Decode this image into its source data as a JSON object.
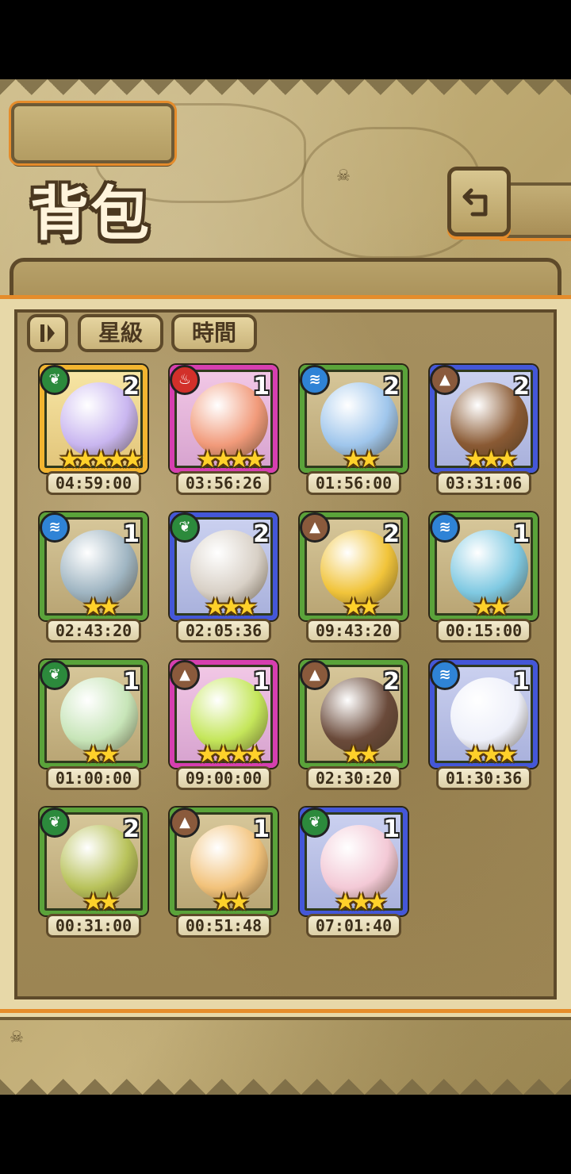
{
  "title": "背包",
  "filters": {
    "sort_icon": "sort-toggle-icon",
    "star_label": "星級",
    "time_label": "時間"
  },
  "cards": [
    {
      "element": "nature",
      "count": "2",
      "stars": 5,
      "timer": "04:59:00",
      "art": "#c9b6f0"
    },
    {
      "element": "fire",
      "count": "1",
      "stars": 4,
      "timer": "03:56:26",
      "art": "#f19a7a"
    },
    {
      "element": "water",
      "count": "2",
      "stars": 2,
      "timer": "01:56:00",
      "art": "#9fc6ec"
    },
    {
      "element": "earth",
      "count": "2",
      "stars": 3,
      "timer": "03:31:06",
      "art": "#8a5a34"
    },
    {
      "element": "water",
      "count": "1",
      "stars": 2,
      "timer": "02:43:20",
      "art": "#9fb5c2"
    },
    {
      "element": "nature",
      "count": "2",
      "stars": 3,
      "timer": "02:05:36",
      "art": "#d8d0c6"
    },
    {
      "element": "earth",
      "count": "2",
      "stars": 2,
      "timer": "09:43:20",
      "art": "#f1c43a"
    },
    {
      "element": "water",
      "count": "1",
      "stars": 2,
      "timer": "00:15:00",
      "art": "#7fc9e2"
    },
    {
      "element": "nature",
      "count": "1",
      "stars": 2,
      "timer": "01:00:00",
      "art": "#c7e5b8"
    },
    {
      "element": "earth",
      "count": "1",
      "stars": 4,
      "timer": "09:00:00",
      "art": "#c4e65a"
    },
    {
      "element": "earth",
      "count": "2",
      "stars": 2,
      "timer": "02:30:20",
      "art": "#6a4a3a"
    },
    {
      "element": "water",
      "count": "1",
      "stars": 3,
      "timer": "01:30:36",
      "art": "#eef0fa"
    },
    {
      "element": "nature",
      "count": "2",
      "stars": 2,
      "timer": "00:31:00",
      "art": "#b8c25a"
    },
    {
      "element": "earth",
      "count": "1",
      "stars": 2,
      "timer": "00:51:48",
      "art": "#f2c27a"
    },
    {
      "element": "nature",
      "count": "1",
      "stars": 3,
      "timer": "07:01:40",
      "art": "#f3c9d6"
    }
  ]
}
